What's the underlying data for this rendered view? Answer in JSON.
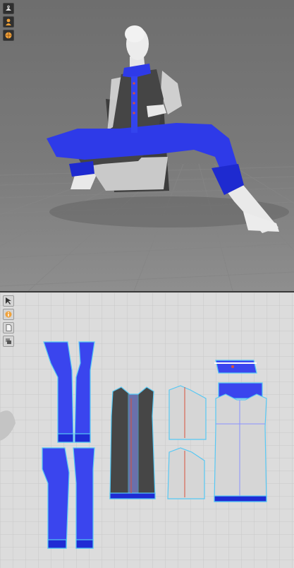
{
  "viewport_3d": {
    "toolbar": [
      {
        "icon": "hanger-icon"
      },
      {
        "icon": "avatar-icon"
      },
      {
        "icon": "texture-ball-icon"
      }
    ]
  },
  "viewport_2d": {
    "toolbar": [
      {
        "icon": "select-arrow-icon"
      },
      {
        "icon": "info-icon"
      },
      {
        "icon": "sheet-icon"
      },
      {
        "icon": "layers-icon"
      }
    ]
  },
  "colors": {
    "garment_blue": "#3344ee",
    "garment_dark": "#474747",
    "garment_light": "#d6d6d6",
    "avatar": "#e8e8e8",
    "outline": "#46c2f2"
  }
}
